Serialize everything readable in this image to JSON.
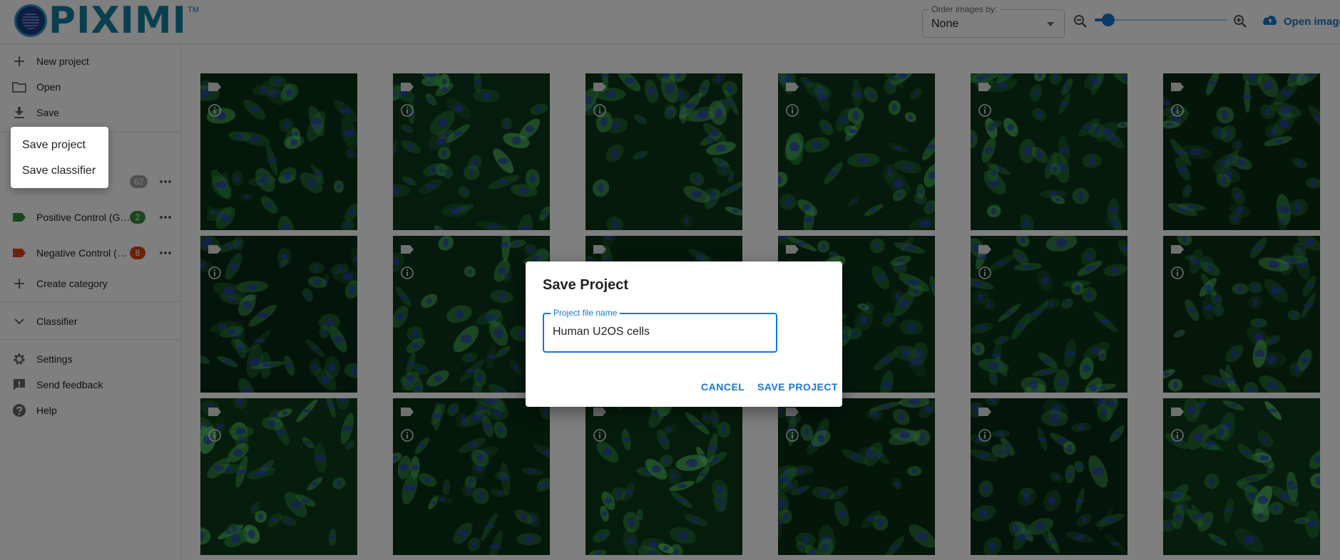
{
  "app": {
    "logo_text": "PIXIMI",
    "logo_tm": "TM",
    "accent": "#1976d2"
  },
  "toolbar": {
    "order_label": "Order images by:",
    "order_value": "None",
    "zoom_level": 0.1,
    "open_image_label": "Open image"
  },
  "sidebar": {
    "file_items": [
      {
        "label": "New project",
        "icon": "plus-icon"
      },
      {
        "label": "Open",
        "icon": "folder-icon"
      },
      {
        "label": "Save",
        "icon": "download-icon"
      }
    ],
    "categories": [
      {
        "label": "",
        "count": "62",
        "color": "#9e9e9e"
      },
      {
        "label": "Positive Control (G…",
        "count": "2",
        "color": "#388e3c"
      },
      {
        "label": "Negative Control (…",
        "count": "8",
        "color": "#d84315"
      }
    ],
    "create_category_label": "Create category",
    "classifier_label": "Classifier",
    "bottom_items": [
      {
        "label": "Settings",
        "icon": "gear-icon"
      },
      {
        "label": "Send feedback",
        "icon": "feedback-icon"
      },
      {
        "label": "Help",
        "icon": "help-icon"
      }
    ]
  },
  "save_menu": {
    "items": [
      "Save project",
      "Save classifier"
    ]
  },
  "dialog": {
    "title": "Save Project",
    "field_label": "Project file name",
    "field_value": "Human U2OS cells",
    "cancel_label": "CANCEL",
    "confirm_label": "SAVE PROJECT"
  },
  "images": {
    "rows": 3,
    "columns": 6,
    "count": 18
  }
}
